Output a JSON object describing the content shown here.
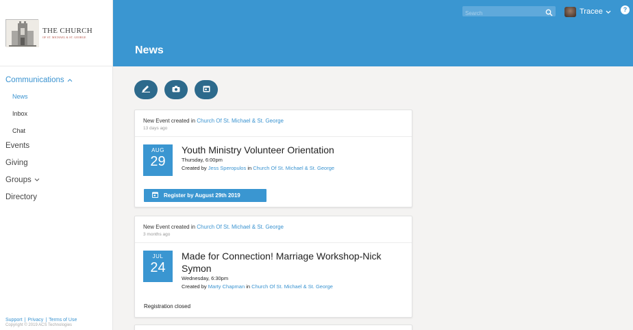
{
  "sidebar": {
    "logo": {
      "title": "THE CHURCH",
      "subtitle": "OF ST. MICHAEL & ST. GEORGE"
    },
    "items": [
      {
        "label": "Communications",
        "caret": "^"
      },
      {
        "label": "News"
      },
      {
        "label": "Inbox"
      },
      {
        "label": "Chat"
      },
      {
        "label": "Events"
      },
      {
        "label": "Giving"
      },
      {
        "label": "Groups",
        "caret": "v"
      },
      {
        "label": "Directory"
      }
    ],
    "footer": {
      "support": "Support",
      "privacy": "Privacy",
      "terms": "Terms of Use",
      "separator": "|",
      "copyright": "Copyright © 2019 ACS Technologies"
    }
  },
  "header": {
    "title": "News",
    "search_placeholder": "Search",
    "user_name": "Tracee",
    "help": "?"
  },
  "actions": [
    {
      "icon": "pencil-icon"
    },
    {
      "icon": "camera-icon"
    },
    {
      "icon": "calendar-icon"
    }
  ],
  "posts": [
    {
      "prefix": "New Event created in",
      "church": "Church Of St. Michael & St. George",
      "time": "13 days ago",
      "month": "AUG",
      "day": "29",
      "title": "Youth Ministry Volunteer Orientation",
      "when": "Thursday, 6:00pm",
      "created_by_label": "Created by",
      "author": "Jess Speropulos",
      "in_label": "in",
      "author_church": "Church Of St. Michael & St. George",
      "register": "Register by August 29th 2019"
    },
    {
      "prefix": "New Event created in",
      "church": "Church Of St. Michael & St. George",
      "time": "3 months ago",
      "month": "JUL",
      "day": "24",
      "title": "Made for Connection! Marriage Workshop-Nick Symon",
      "when": "Wednesday, 6:30pm",
      "created_by_label": "Created by",
      "author": "Marty Chapman",
      "in_label": "in",
      "author_church": "Church Of St. Michael & St. George",
      "status": "Registration closed"
    }
  ],
  "colors": {
    "accent": "#3a96d1",
    "dark_button": "#2d6a8c",
    "background": "#f4f3f2"
  }
}
